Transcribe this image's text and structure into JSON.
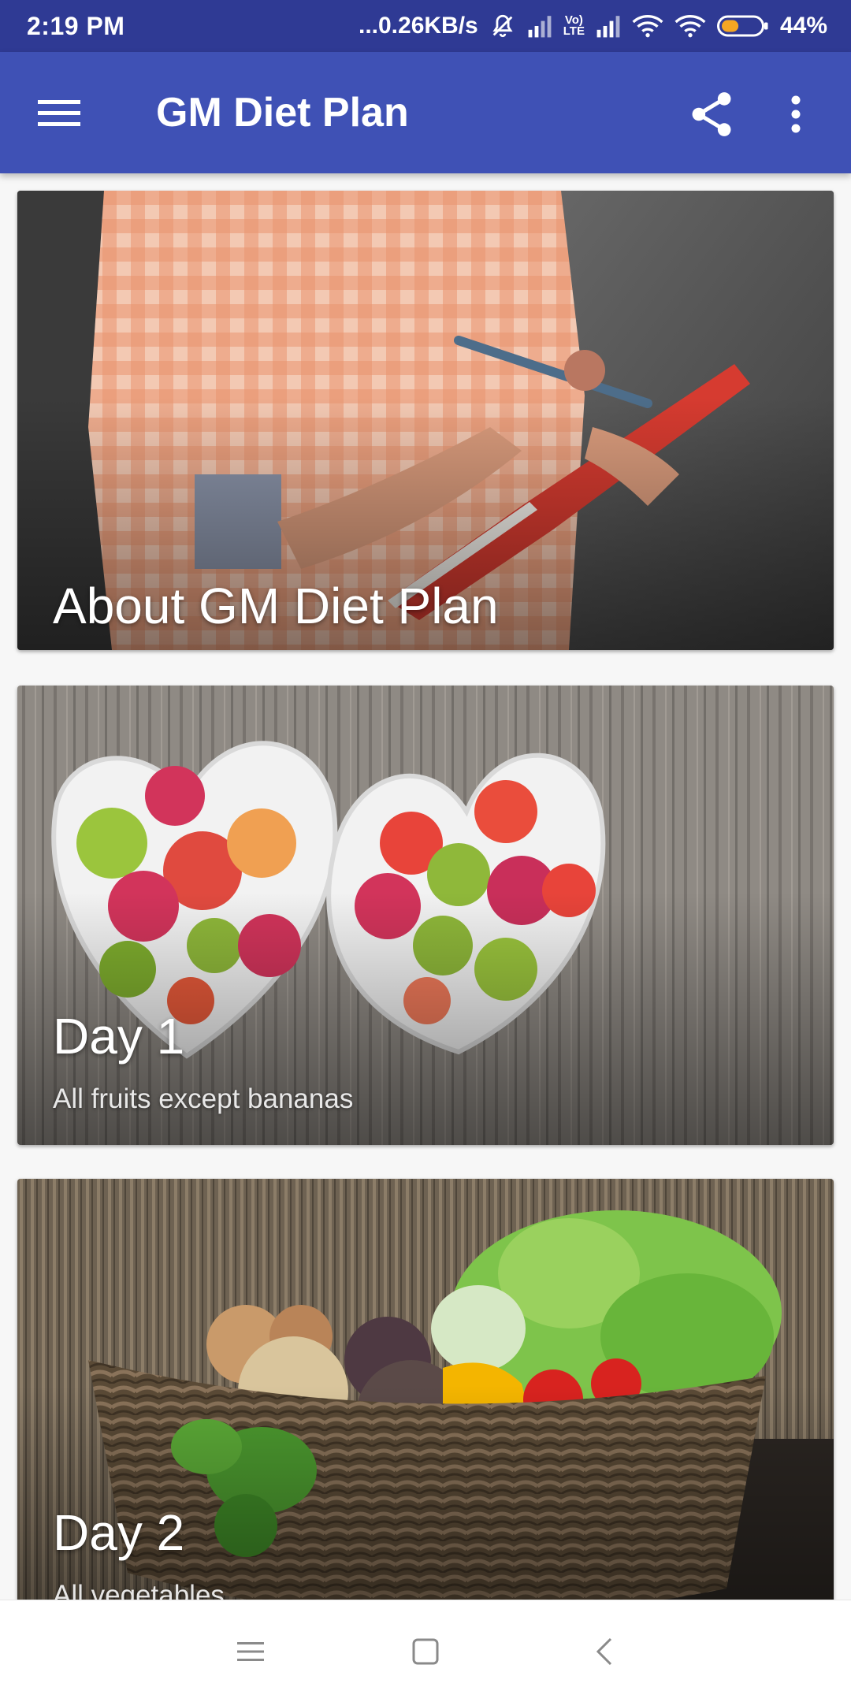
{
  "status_bar": {
    "time": "2:19 PM",
    "network_speed": "...0.26KB/s",
    "lte_label_top": "Vo)",
    "lte_label_bottom": "LTE",
    "battery_percent": "44%",
    "battery_level": 0.44,
    "icons": [
      "mute-icon",
      "signal-icon",
      "volte-icon",
      "signal-icon",
      "wifi-icon",
      "wifi-icon",
      "battery-icon"
    ]
  },
  "app_bar": {
    "title": "GM Diet Plan",
    "icons": [
      "menu-icon",
      "share-icon",
      "more-vert-icon"
    ]
  },
  "cards": [
    {
      "title": "About GM Diet Plan",
      "subtitle": ""
    },
    {
      "title": "Day 1",
      "subtitle": "All fruits except bananas"
    },
    {
      "title": "Day 2",
      "subtitle": "All  vegetables"
    }
  ],
  "nav_bar": {
    "icons": [
      "recents-icon",
      "home-icon",
      "back-icon"
    ]
  },
  "colors": {
    "status_bar": "#2f3a94",
    "app_bar": "#3f51b5",
    "background": "#f7f7f7",
    "battery_fill": "#f5a623"
  }
}
